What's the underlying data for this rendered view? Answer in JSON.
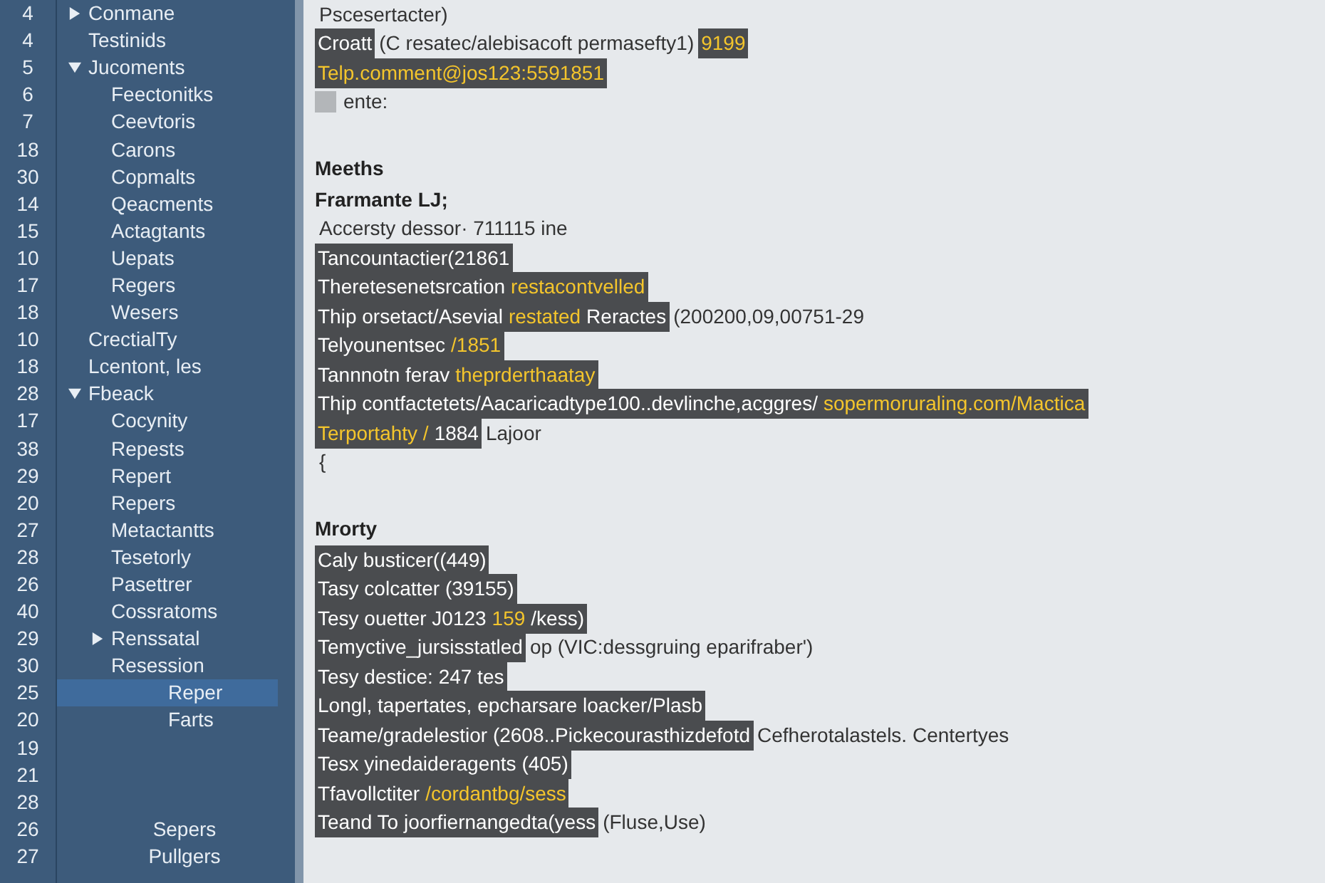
{
  "gutter": {
    "line_numbers": [
      "4",
      "4",
      "5",
      "6",
      "7",
      "18",
      "30",
      "14",
      "15",
      "10",
      "17",
      "18",
      "10",
      "18",
      "28",
      "17",
      "38",
      "29",
      "20",
      "27",
      "28",
      "26",
      "40",
      "29",
      "30",
      "25",
      "20",
      "19",
      "21",
      "28",
      "26",
      "27"
    ]
  },
  "tree": [
    {
      "label": "Conmane",
      "expanded": false,
      "selected": false
    },
    {
      "label": "Testinids",
      "selected": false
    },
    {
      "label": "Jucoments",
      "expanded": true,
      "selected": false,
      "children": [
        {
          "label": "Feectonitks",
          "selected": false
        },
        {
          "label": "Ceevtoris",
          "selected": false
        },
        {
          "label": "Carons",
          "selected": false
        },
        {
          "label": "Copmalts",
          "selected": false
        },
        {
          "label": "Qeacments",
          "selected": false
        },
        {
          "label": "Actagtants",
          "selected": false
        },
        {
          "label": "Uepats",
          "selected": false
        },
        {
          "label": "Regers",
          "selected": false
        },
        {
          "label": "Wesers",
          "selected": false
        }
      ]
    },
    {
      "label": "CrectialTy",
      "selected": false
    },
    {
      "label": "Lcentont, les",
      "selected": false
    },
    {
      "label": "Fbeack",
      "expanded": true,
      "selected": false,
      "children": [
        {
          "label": "Cocynity",
          "selected": false
        },
        {
          "label": "Repests",
          "selected": false
        },
        {
          "label": "Repert",
          "selected": false
        },
        {
          "label": "Repers",
          "selected": false
        },
        {
          "label": "Metactantts",
          "selected": false
        },
        {
          "label": "Tesetorly",
          "selected": false
        },
        {
          "label": "Pasettrer",
          "selected": false
        },
        {
          "label": "Cossratoms",
          "selected": false
        },
        {
          "label": "Renssatal",
          "expanded": false,
          "selected": false
        },
        {
          "label": "Resession",
          "selected": false,
          "children": [
            {
              "label": "Reper",
              "selected": true
            },
            {
              "label": "Farts",
              "selected": false
            }
          ]
        }
      ]
    }
  ],
  "footer_items": [
    "Sepers",
    "Pullgers"
  ],
  "sections": [
    {
      "lines": [
        {
          "segments": [
            {
              "kind": "plain",
              "text": "Pscesertacter)"
            }
          ]
        },
        {
          "segments": [
            {
              "kind": "dark",
              "text": "Croatt"
            },
            {
              "kind": "plain",
              "text": "(C resatec/alebisacoft permasefty1)"
            },
            {
              "kind": "accent",
              "text": "9199"
            }
          ]
        },
        {
          "segments": [
            {
              "kind": "accent",
              "text": "Telp.comment@jos123:5591851"
            }
          ]
        },
        {
          "bullet": true,
          "segments": [
            {
              "kind": "plain",
              "text": "ente:"
            }
          ]
        }
      ]
    },
    {
      "heading": "Meeths",
      "lines": [
        {
          "segments": [
            {
              "kind": "bold",
              "text": "Frarmante LJ;"
            }
          ]
        },
        {
          "segments": [
            {
              "kind": "plain",
              "text": "Accersty dessor· 711115 ine"
            }
          ]
        },
        {
          "segments": [
            {
              "kind": "dark",
              "text": "Tancountactier(21861"
            }
          ]
        },
        {
          "segments": [
            {
              "kind": "dark",
              "text": "Theretesenetsrcation"
            },
            {
              "kind": "accent",
              "text": "restacontvelled"
            }
          ]
        },
        {
          "segments": [
            {
              "kind": "dark",
              "text": "Thip orsetact/Asevial"
            },
            {
              "kind": "accent",
              "text": "restated"
            },
            {
              "kind": "dark",
              "text": " Reractes"
            },
            {
              "kind": "plain",
              "text": "(200200,09,00751-29"
            }
          ]
        },
        {
          "segments": [
            {
              "kind": "dark",
              "text": "Telyounentsec"
            },
            {
              "kind": "accent",
              "text": "/1851"
            }
          ]
        },
        {
          "segments": [
            {
              "kind": "dark",
              "text": "Tannnotn ferav"
            },
            {
              "kind": "accent",
              "text": "theprderthaatay"
            }
          ]
        },
        {
          "segments": [
            {
              "kind": "dark",
              "text": "Thip contfactetets/Aacaricadtype100..devlinche,acggres/"
            },
            {
              "kind": "accent",
              "text": "sopermoruraling.com/Mactica"
            }
          ]
        },
        {
          "segments": [
            {
              "kind": "accent",
              "text": "Terportahty /"
            },
            {
              "kind": "dark",
              "text": "1884"
            },
            {
              "kind": "plain",
              "text": "Lajoor"
            }
          ]
        },
        {
          "segments": [
            {
              "kind": "plain",
              "text": "{"
            }
          ]
        }
      ]
    },
    {
      "heading": "Mrorty",
      "lines": [
        {
          "segments": [
            {
              "kind": "dark",
              "text": "Caly busticer((449)"
            }
          ]
        },
        {
          "segments": [
            {
              "kind": "dark",
              "text": "Tasy colcatter (39155)"
            }
          ]
        },
        {
          "segments": [
            {
              "kind": "dark",
              "text": "Tesy ouetter J0123"
            },
            {
              "kind": "accent",
              "text": "159"
            },
            {
              "kind": "dark",
              "text": "/kess)"
            }
          ]
        },
        {
          "segments": [
            {
              "kind": "dark",
              "text": "Temyctive_jursisstatled"
            },
            {
              "kind": "plain",
              "text": "op (VIC:dessgruing eparifraber')"
            }
          ]
        },
        {
          "segments": [
            {
              "kind": "dark",
              "text": "Tesy destice: 247 tes"
            }
          ]
        },
        {
          "segments": [
            {
              "kind": "dark",
              "text": "Longl, tapertates, epcharsare loacker/Plasb"
            }
          ]
        },
        {
          "segments": [
            {
              "kind": "dark",
              "text": "Teame/gradelestior (2608..Pickecourasthizdefotd"
            },
            {
              "kind": "plain",
              "text": "Cefherotalastels. Centertyes"
            }
          ]
        },
        {
          "segments": [
            {
              "kind": "dark",
              "text": "Tesx yinedaideragents (405)"
            }
          ]
        },
        {
          "segments": [
            {
              "kind": "dark",
              "text": "Tfavollctiter"
            },
            {
              "kind": "accent",
              "text": "/cordantbg/sess"
            }
          ]
        },
        {
          "segments": [
            {
              "kind": "dark",
              "text": "Teand To joorfiernangedta(yess"
            },
            {
              "kind": "plain",
              "text": "(Fluse,Use)"
            }
          ]
        }
      ]
    }
  ]
}
